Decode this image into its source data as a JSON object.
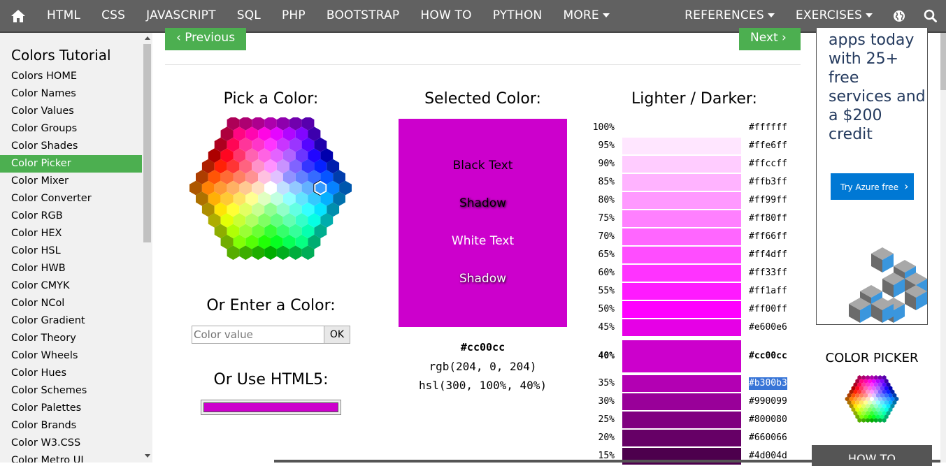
{
  "nav": {
    "items": [
      "HTML",
      "CSS",
      "JAVASCRIPT",
      "SQL",
      "PHP",
      "BOOTSTRAP",
      "HOW TO",
      "PYTHON"
    ],
    "more": "MORE",
    "references": "REFERENCES",
    "exercises": "EXERCISES",
    "icons": [
      "home-icon",
      "globe-icon",
      "search-icon"
    ]
  },
  "sidebar": {
    "title": "Colors Tutorial",
    "items": [
      "Colors HOME",
      "Color Names",
      "Color Values",
      "Color Groups",
      "Color Shades",
      "Color Picker",
      "Color Mixer",
      "Color Converter",
      "Color RGB",
      "Color HEX",
      "Color HSL",
      "Color HWB",
      "Color CMYK",
      "Color NCol",
      "Color Gradient",
      "Color Theory",
      "Color Wheels",
      "Color Hues",
      "Color Schemes",
      "Color Palettes",
      "Color Brands",
      "Color W3.CSS",
      "Color Metro UI"
    ],
    "active": "Color Picker"
  },
  "main": {
    "previous": "Previous",
    "next": "Next",
    "pick_title": "Pick a Color:",
    "enter_title": "Or Enter a Color:",
    "input_placeholder": "Color value",
    "ok_label": "OK",
    "html5_title": "Or Use HTML5:",
    "selected_title": "Selected Color:",
    "selected_color": "#cc00cc",
    "box_texts": [
      "Black Text",
      "Shadow",
      "White Text",
      "Shadow"
    ],
    "hex": "#cc00cc",
    "rgb": "rgb(204, 0, 204)",
    "hsl": "hsl(300, 100%, 40%)",
    "shades_title": "Lighter / Darker:",
    "shades": [
      {
        "pct": "100%",
        "hex": "#ffffff"
      },
      {
        "pct": "95%",
        "hex": "#ffe6ff"
      },
      {
        "pct": "90%",
        "hex": "#ffccff"
      },
      {
        "pct": "85%",
        "hex": "#ffb3ff"
      },
      {
        "pct": "80%",
        "hex": "#ff99ff"
      },
      {
        "pct": "75%",
        "hex": "#ff80ff"
      },
      {
        "pct": "70%",
        "hex": "#ff66ff"
      },
      {
        "pct": "65%",
        "hex": "#ff4dff"
      },
      {
        "pct": "60%",
        "hex": "#ff33ff"
      },
      {
        "pct": "55%",
        "hex": "#ff1aff"
      },
      {
        "pct": "50%",
        "hex": "#ff00ff"
      },
      {
        "pct": "45%",
        "hex": "#e600e6"
      },
      {
        "pct": "40%",
        "hex": "#cc00cc"
      },
      {
        "pct": "35%",
        "hex": "#b300b3"
      },
      {
        "pct": "30%",
        "hex": "#990099"
      },
      {
        "pct": "25%",
        "hex": "#800080"
      },
      {
        "pct": "20%",
        "hex": "#660066"
      },
      {
        "pct": "15%",
        "hex": "#4d004d"
      }
    ]
  },
  "ad": {
    "text": "apps today with 25+ free services and a $200 credit",
    "button": "Try Azure free"
  },
  "right": {
    "color_picker_title": "COLOR PICKER",
    "howto": "HOW TO"
  },
  "colors": {
    "nav_bg": "#616161",
    "green": "#4caf50",
    "selected": "#cc00cc",
    "azure": "#0078d4"
  }
}
